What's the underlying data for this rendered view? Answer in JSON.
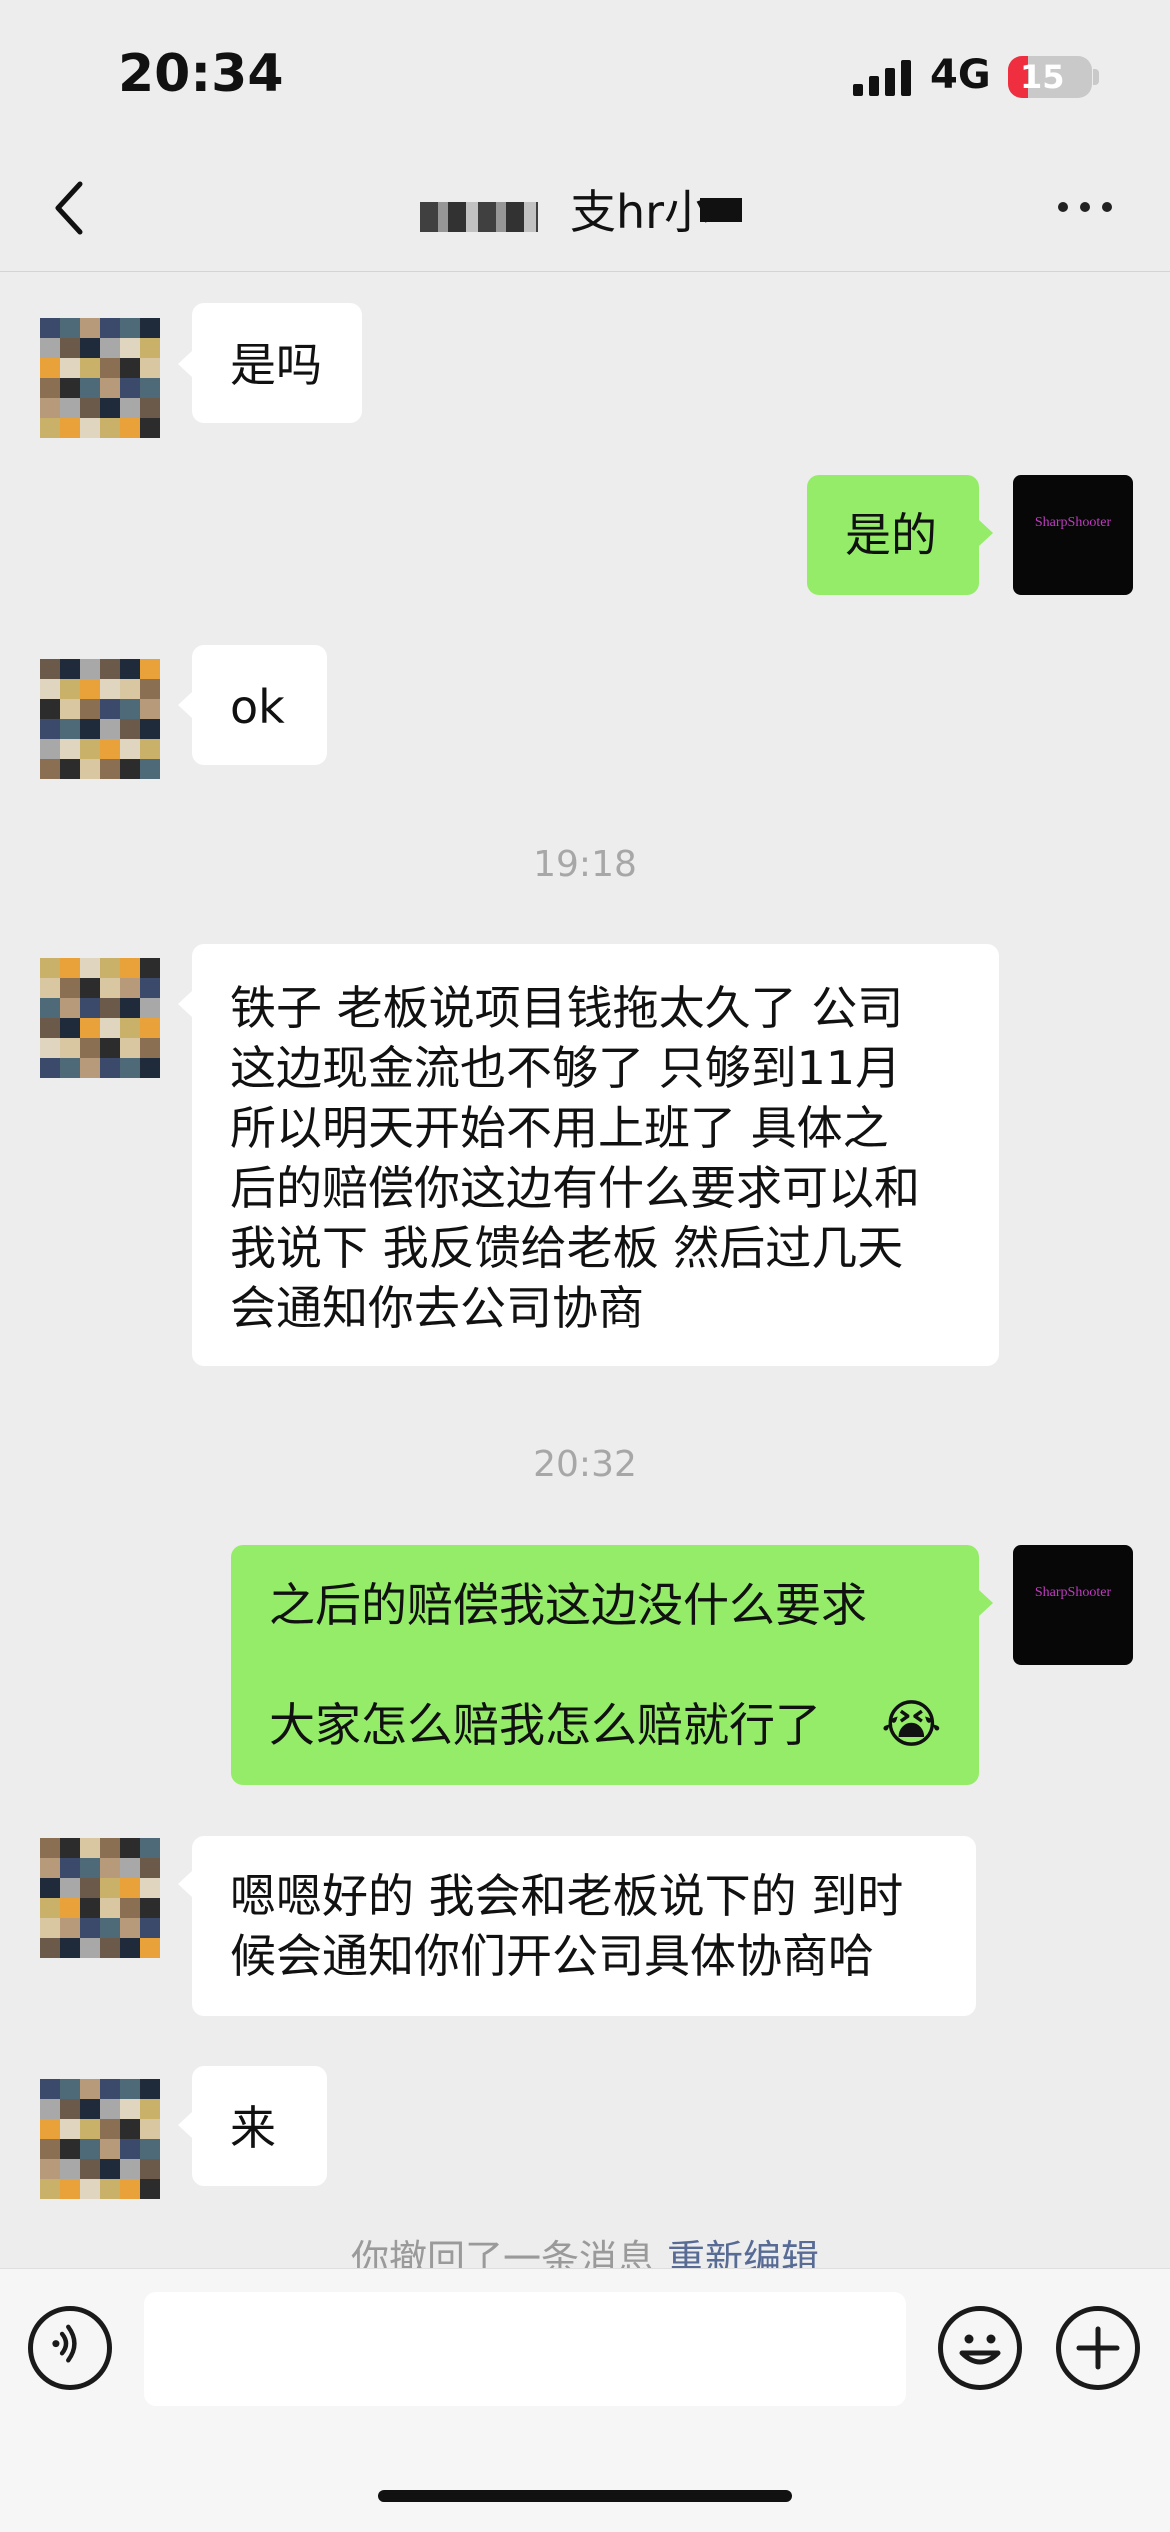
{
  "status_bar": {
    "time": "20:34",
    "network": "4G",
    "battery": "15"
  },
  "header": {
    "title_fragment": "支hr小"
  },
  "messages": [
    {
      "side": "in",
      "text": "是吗"
    },
    {
      "side": "out",
      "text": "是的"
    },
    {
      "side": "in",
      "text": "ok"
    },
    {
      "side": "in",
      "lines": [
        "铁子 老板说项目钱拖太久了 公司",
        "这边现金流也不够了 只够到11月",
        "所以明天开始不用上班了 具体之",
        "后的赔偿你这边有什么要求可以和",
        "我说下 我反馈给老板 然后过几天",
        "会通知你去公司协商"
      ]
    },
    {
      "side": "out",
      "lines": [
        "之后的赔偿我这边没什么要求",
        "大家怎么赔我怎么赔就行了"
      ],
      "emoji": "😭"
    },
    {
      "side": "in",
      "lines": [
        "嗯嗯好的 我会和老板说下的 到时",
        "候会通知你们开公司具体协商哈"
      ]
    },
    {
      "side": "in",
      "text": "来"
    }
  ],
  "timestamps": [
    "19:18",
    "20:32"
  ],
  "recall_notice": {
    "text": "你撤回了一条消息",
    "action": "重新编辑"
  },
  "my_avatar_label": "SharpShooter",
  "colors": {
    "outgoing_bubble": "#95ec69",
    "incoming_bubble": "#ffffff",
    "background": "#ededed",
    "link": "#576b95"
  },
  "icons": {
    "back": "chevron-left-icon",
    "more": "more-dots-icon",
    "voice": "voice-icon",
    "emoji": "emoji-icon",
    "plus": "plus-icon"
  }
}
